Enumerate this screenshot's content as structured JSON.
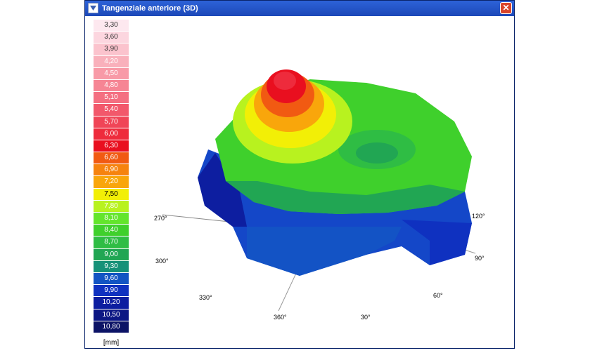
{
  "window": {
    "title": "Tangenziale anteriore (3D)",
    "close_symbol": "✕"
  },
  "legend": {
    "unit": "[mm]",
    "items": [
      {
        "label": "3,30",
        "color": "#fde8ef",
        "text": "#333"
      },
      {
        "label": "3,60",
        "color": "#fcd6df",
        "text": "#333"
      },
      {
        "label": "3,90",
        "color": "#fbc3cd",
        "text": "#333"
      },
      {
        "label": "4,20",
        "color": "#f9b0bb",
        "text": "#fff"
      },
      {
        "label": "4,50",
        "color": "#f89aa7",
        "text": "#fff"
      },
      {
        "label": "4,80",
        "color": "#f68594",
        "text": "#fff"
      },
      {
        "label": "5,10",
        "color": "#f46f81",
        "text": "#fff"
      },
      {
        "label": "5,40",
        "color": "#f2586b",
        "text": "#fff"
      },
      {
        "label": "5,70",
        "color": "#f04557",
        "text": "#fff"
      },
      {
        "label": "6,00",
        "color": "#ee2b3c",
        "text": "#fff"
      },
      {
        "label": "6,30",
        "color": "#e90f1f",
        "text": "#fff"
      },
      {
        "label": "6,60",
        "color": "#f15a12",
        "text": "#fff"
      },
      {
        "label": "6,90",
        "color": "#f6830f",
        "text": "#fff"
      },
      {
        "label": "7,20",
        "color": "#f9a60b",
        "text": "#fff"
      },
      {
        "label": "7,50",
        "color": "#f2ef06",
        "text": "#000"
      },
      {
        "label": "7,80",
        "color": "#b8f21f",
        "text": "#fff"
      },
      {
        "label": "8,10",
        "color": "#63e52c",
        "text": "#fff"
      },
      {
        "label": "8,40",
        "color": "#3fd02c",
        "text": "#fff"
      },
      {
        "label": "8,70",
        "color": "#2fbd44",
        "text": "#fff"
      },
      {
        "label": "9,00",
        "color": "#21a653",
        "text": "#fff"
      },
      {
        "label": "9,30",
        "color": "#169178",
        "text": "#fff"
      },
      {
        "label": "9,60",
        "color": "#1254c3",
        "text": "#fff"
      },
      {
        "label": "9,90",
        "color": "#0f31c0",
        "text": "#fff"
      },
      {
        "label": "10,20",
        "color": "#0d1ea0",
        "text": "#fff"
      },
      {
        "label": "10,50",
        "color": "#0c1784",
        "text": "#fff"
      },
      {
        "label": "10,80",
        "color": "#0c1366",
        "text": "#fff"
      }
    ]
  },
  "axes": {
    "a270": "270°",
    "a300": "300°",
    "a330": "330°",
    "a360": "360°",
    "a30": "30°",
    "a60": "60°",
    "a90": "90°",
    "a120": "120°"
  }
}
